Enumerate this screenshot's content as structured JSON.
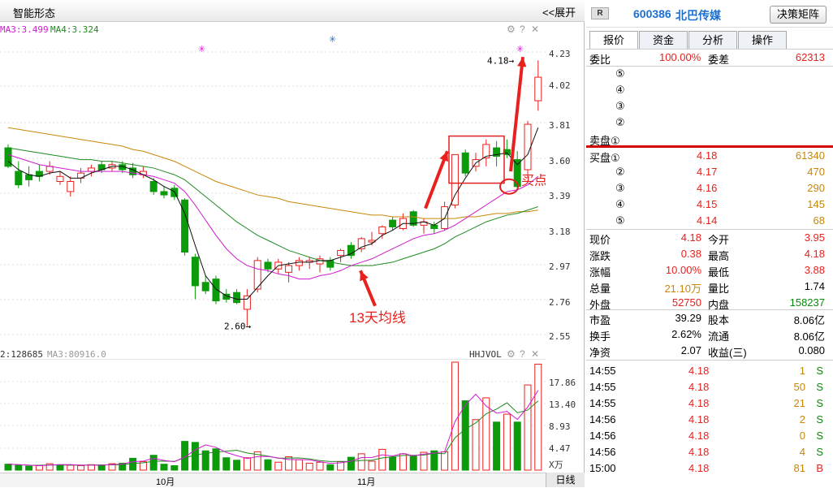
{
  "chart_header": {
    "title": "智能形态",
    "expand_label": "<<展开"
  },
  "price_chart": {
    "ma_line": [
      "MA3:3.499",
      "MA4:3.324"
    ],
    "yticks": [
      "4.23",
      "4.02",
      "3.81",
      "3.60",
      "3.39",
      "3.18",
      "2.97",
      "2.76",
      "2.55"
    ],
    "high_label": "4.18",
    "low_label": "2.60",
    "annotation_buy": "买点",
    "annotation_ma": "13天均线"
  },
  "volume_chart": {
    "ma_line": [
      "2:128685",
      "MA3:80916.0"
    ],
    "indicator": "HHJVOL",
    "yticks": [
      "17.86",
      "13.40",
      "8.93",
      "4.47"
    ],
    "unit": "X万"
  },
  "x_axis": {
    "labels": [
      "10月",
      "11月"
    ],
    "period": "日线"
  },
  "colors": {
    "up": "#e8201e",
    "down": "#0a9a0a",
    "ma_black": "#111111",
    "ma_magenta": "#d01ad0",
    "ma_green": "#1f8a1f",
    "ma_orange": "#c8860a"
  },
  "quote": {
    "badge": "R",
    "code": "600386",
    "name": "北巴传媒",
    "decision_btn": "决策矩阵",
    "tabs": [
      "报价",
      "资金",
      "分析",
      "操作"
    ],
    "weibi_label": "委比",
    "weibi_value": "100.00%",
    "weicha_label": "委差",
    "weicha_value": "62313",
    "sell_levels": [
      {
        "label": "⑤"
      },
      {
        "label": "④"
      },
      {
        "label": "③"
      },
      {
        "label": "②"
      },
      {
        "label": "卖盘①"
      }
    ],
    "buy_levels": [
      {
        "label": "买盘①",
        "price": "4.18",
        "vol": "61340"
      },
      {
        "label": "②",
        "price": "4.17",
        "vol": "470"
      },
      {
        "label": "③",
        "price": "4.16",
        "vol": "290"
      },
      {
        "label": "④",
        "price": "4.15",
        "vol": "145"
      },
      {
        "label": "⑤",
        "price": "4.14",
        "vol": "68"
      }
    ],
    "stats": [
      {
        "l1": "现价",
        "v1": "4.18",
        "l2": "今开",
        "v2": "3.95"
      },
      {
        "l1": "涨跌",
        "v1": "0.38",
        "l2": "最高",
        "v2": "4.18"
      },
      {
        "l1": "涨幅",
        "v1": "10.00%",
        "l2": "最低",
        "v2": "3.88"
      },
      {
        "l1": "总量",
        "v1": "21.10万",
        "l2": "量比",
        "v2": "1.74"
      },
      {
        "l1": "外盘",
        "v1": "52750",
        "l2": "内盘",
        "v2": "158237"
      }
    ],
    "fundamentals": [
      {
        "l1": "市盈",
        "v1": "39.29",
        "l2": "股本",
        "v2": "8.06亿"
      },
      {
        "l1": "换手",
        "v1": "2.62%",
        "l2": "流通",
        "v2": "8.06亿"
      },
      {
        "l1": "净资",
        "v1": "2.07",
        "l2": "收益(三)",
        "v2": "0.080"
      }
    ],
    "ticks": [
      {
        "time": "14:55",
        "price": "4.18",
        "vol": "1",
        "side": "S"
      },
      {
        "time": "14:55",
        "price": "4.18",
        "vol": "50",
        "side": "S"
      },
      {
        "time": "14:55",
        "price": "4.18",
        "vol": "21",
        "side": "S"
      },
      {
        "time": "14:56",
        "price": "4.18",
        "vol": "2",
        "side": "S"
      },
      {
        "time": "14:56",
        "price": "4.18",
        "vol": "0",
        "side": "S"
      },
      {
        "time": "14:56",
        "price": "4.18",
        "vol": "4",
        "side": "S"
      },
      {
        "time": "15:00",
        "price": "4.18",
        "vol": "81",
        "side": "B"
      }
    ]
  }
}
